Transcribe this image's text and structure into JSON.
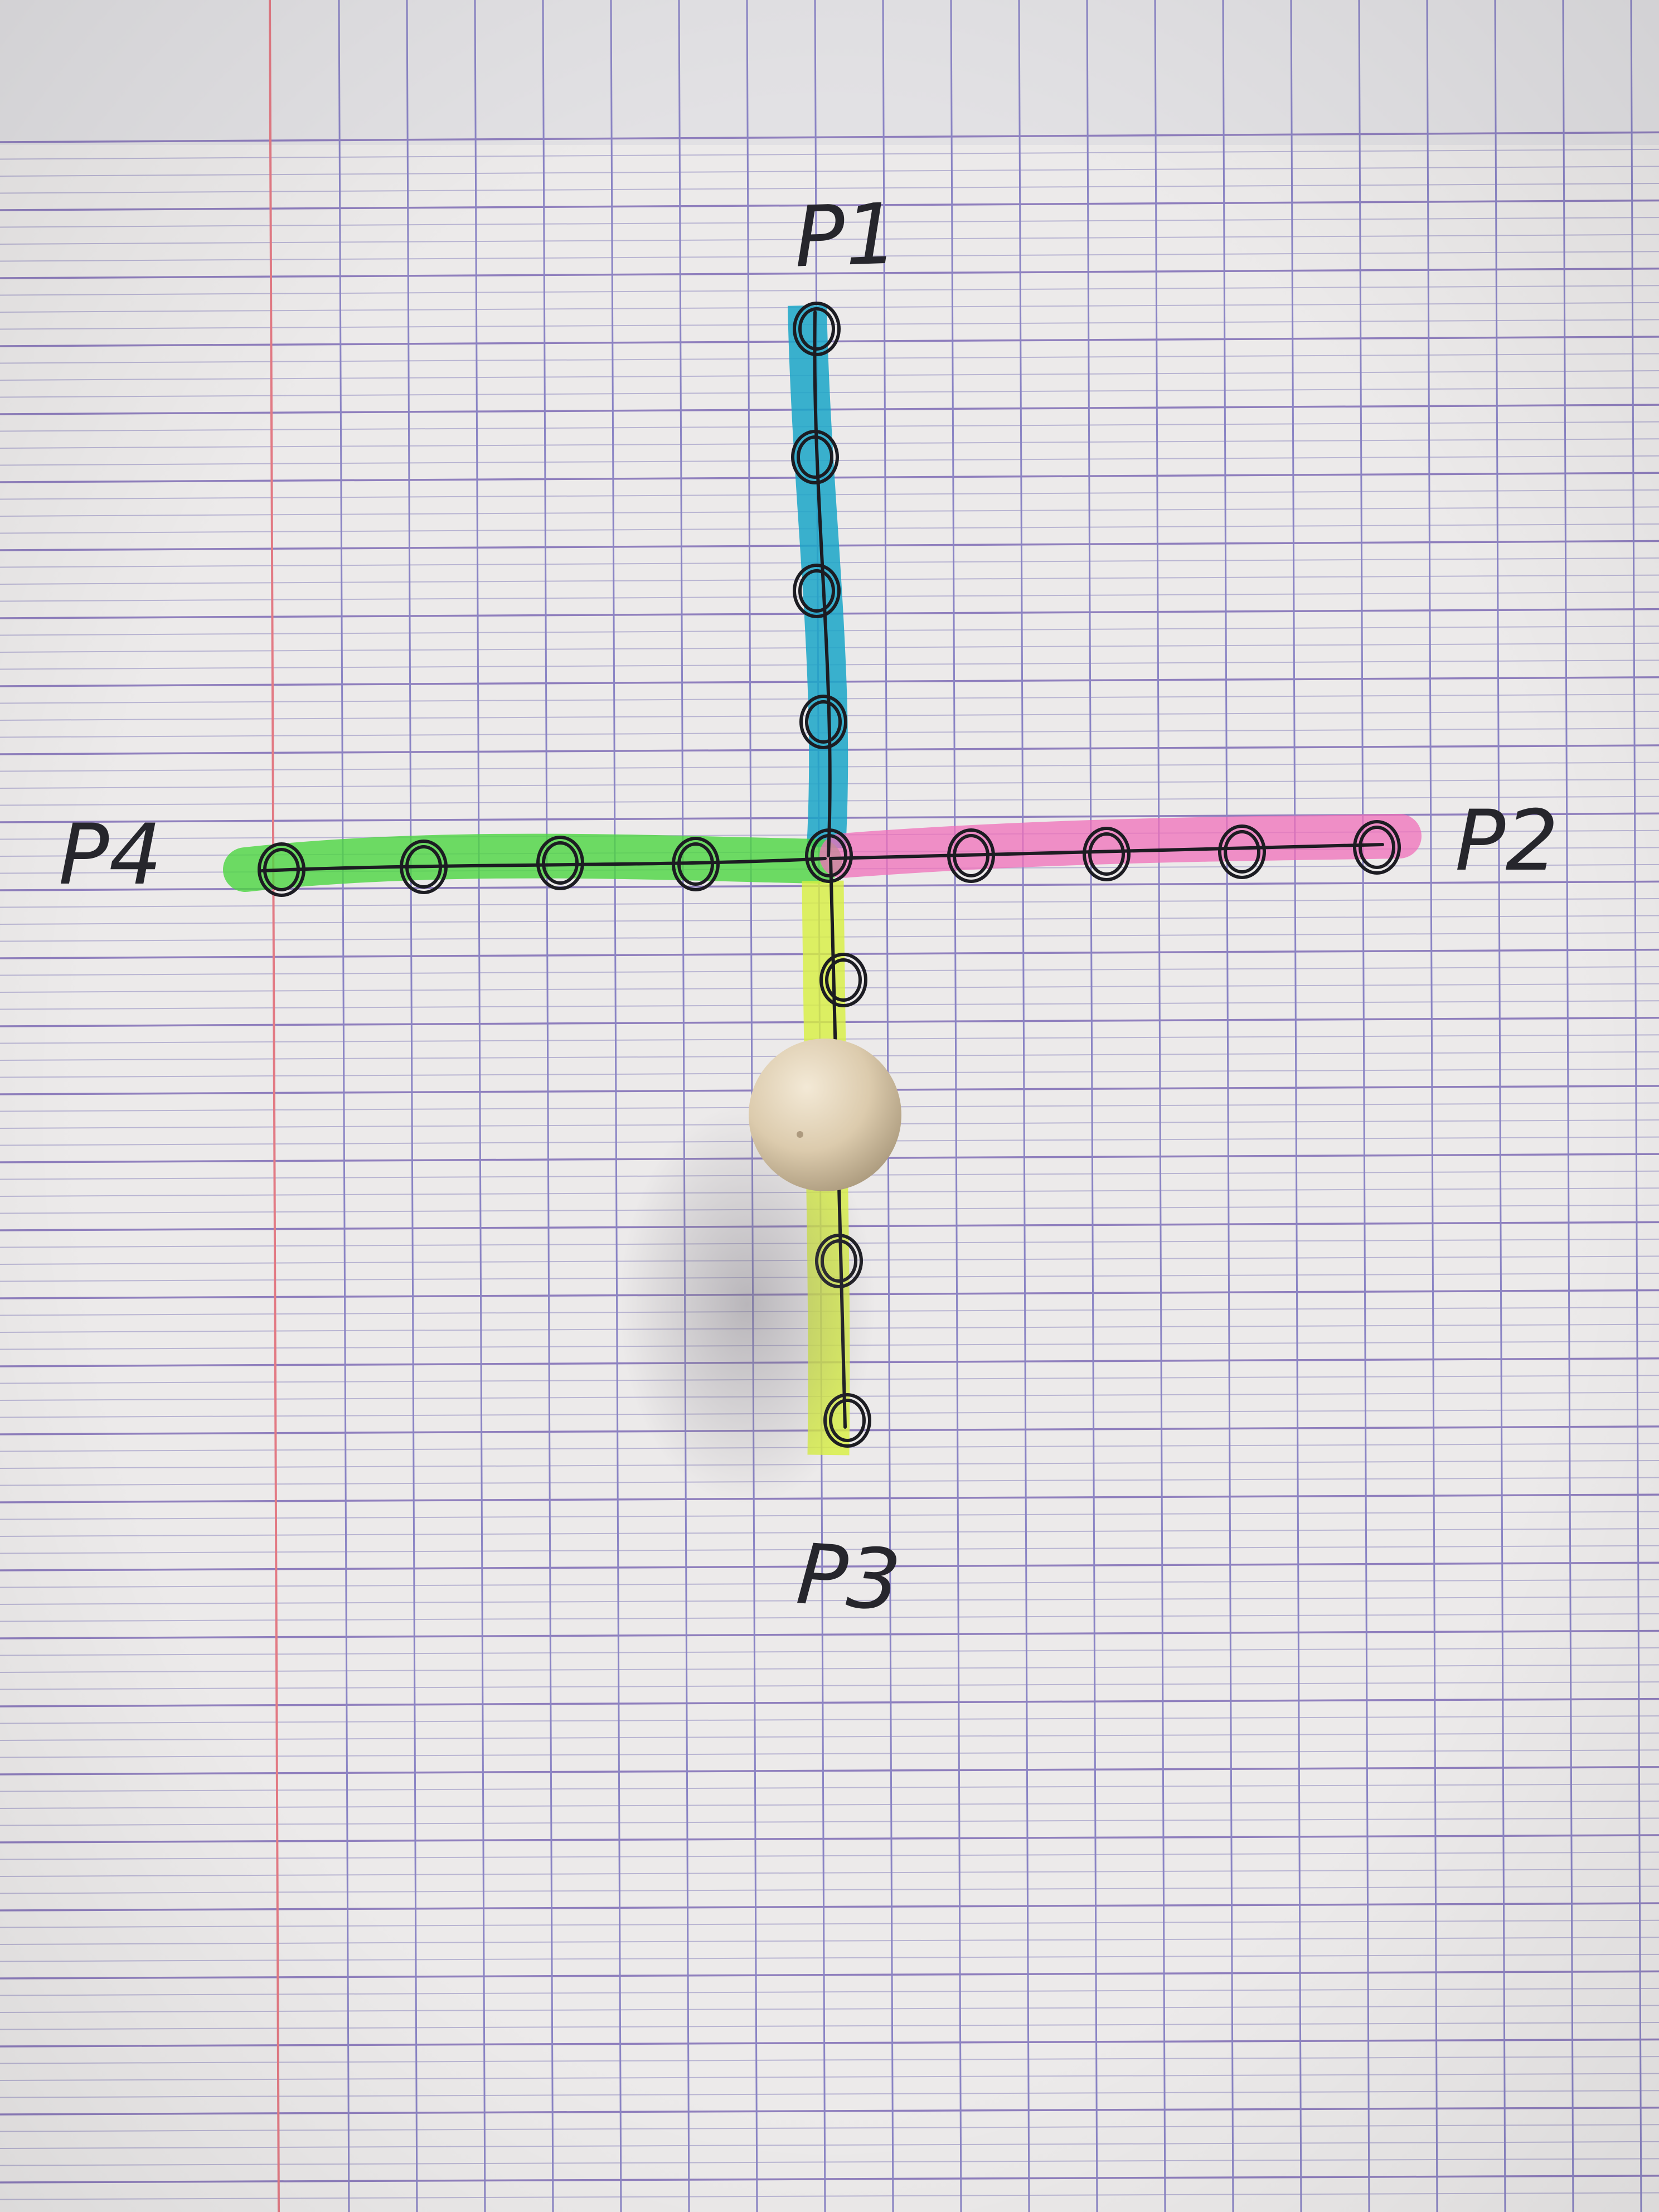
{
  "photo": {
    "labels": {
      "top": "P1",
      "right": "P2",
      "bottom": "P3",
      "left": "P4"
    },
    "highlighter_colors": {
      "p1_arm": "#1aa6c8",
      "p2_arm": "#f06fb9",
      "p3_arm": "#d8f040",
      "p4_arm": "#4cd641"
    },
    "paper": {
      "background": "#eceaea",
      "margin_line": "#e0707a",
      "grid_major": "#8a78b8",
      "grid_minor": "#b5b0cf"
    },
    "ink": "#1c1c22",
    "bead_color": "#d8c9ad"
  }
}
